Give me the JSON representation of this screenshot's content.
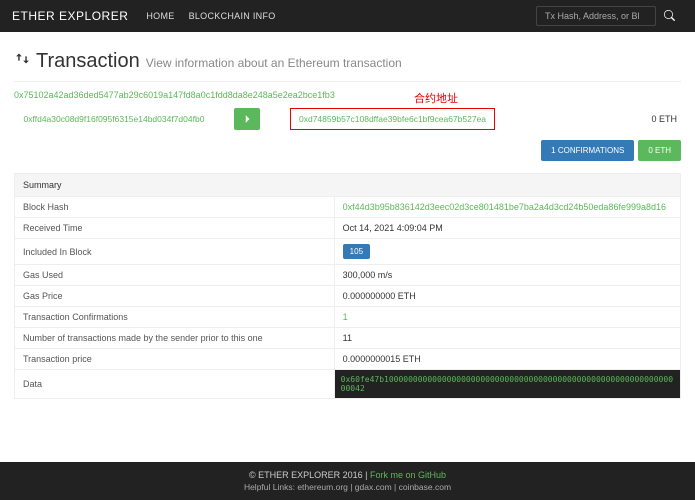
{
  "navbar": {
    "brand": "ETHER EXPLORER",
    "home": "HOME",
    "blockchain_info": "BLOCKCHAIN INFO",
    "search_placeholder": "Tx Hash, Address, or Bl"
  },
  "header": {
    "title": "Transaction",
    "subtitle": "View information about an Ethereum transaction"
  },
  "tx": {
    "hash": "0x75102a42ad36ded5477ab29c6019a147fd8a0c1fdd8da8e248a5e2ea2bce1fb3",
    "from": "0xffd4a30c08d9f16f095f6315e14bd034f7d04fb0",
    "to": "0xd74859b57c108dffae39bfe6c1bf9cea67b527ea",
    "amount": "0 ETH",
    "annotation": "合约地址"
  },
  "badges": {
    "confirmations": "1 CONFIRMATIONS",
    "eth": "0 ETH"
  },
  "summary": {
    "title": "Summary",
    "rows": {
      "block_hash": {
        "label": "Block Hash",
        "value": "0xf44d3b95b836142d3eec02d3ce801481be7ba2a4d3cd24b50eda86fe999a8d16"
      },
      "received_time": {
        "label": "Received Time",
        "value": "Oct 14, 2021 4:09:04 PM"
      },
      "included_block": {
        "label": "Included In Block",
        "value": "105"
      },
      "gas_used": {
        "label": "Gas Used",
        "value": "300,000 m/s"
      },
      "gas_price": {
        "label": "Gas Price",
        "value": "0.000000000 ETH"
      },
      "tx_confirmations": {
        "label": "Transaction Confirmations",
        "value": "1"
      },
      "nonce": {
        "label": "Number of transactions made by the sender prior to this one",
        "value": "11"
      },
      "tx_price": {
        "label": "Transaction price",
        "value": "0.0000000015 ETH"
      },
      "data": {
        "label": "Data",
        "value": "0x60fe47b10000000000000000000000000000000000000000000000000000000000000042"
      }
    }
  },
  "footer": {
    "copyright": "© ETHER EXPLORER 2016 | ",
    "fork": "Fork me on GitHub",
    "links": "Helpful Links: ethereum.org | gdax.com | coinbase.com"
  }
}
